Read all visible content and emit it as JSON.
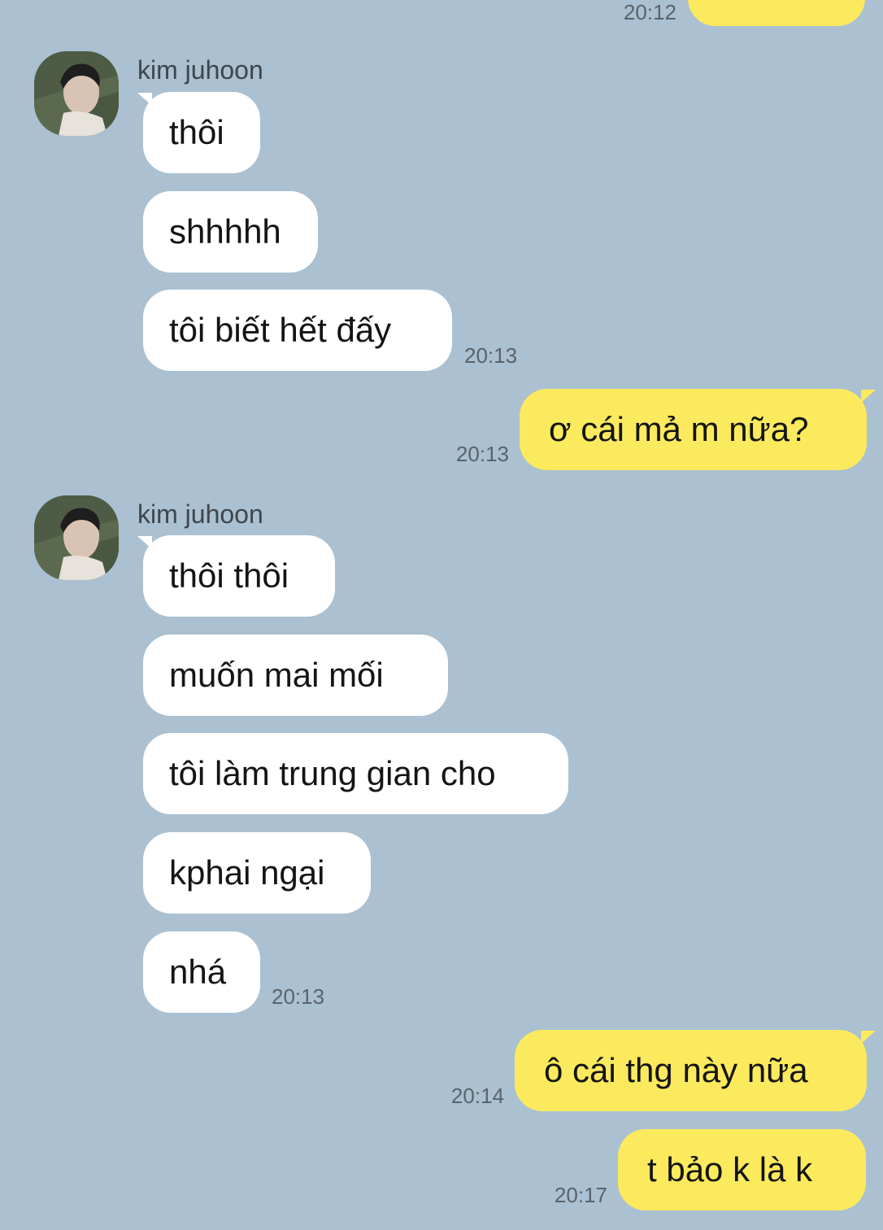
{
  "chat": {
    "top_partial": {
      "time": "20:12"
    },
    "group1": {
      "sender": "kim juhoon",
      "avatar_icon": "contact-photo-icon",
      "messages": [
        "thôi",
        "shhhhh",
        "tôi biết hết đấy"
      ],
      "time": "20:13"
    },
    "reply1": {
      "text": "ơ cái mả m nữa?",
      "time": "20:13"
    },
    "group2": {
      "sender": "kim juhoon",
      "avatar_icon": "contact-photo-icon",
      "messages": [
        "thôi thôi",
        "muốn mai mối",
        "tôi làm trung gian cho",
        "kphai ngại",
        "nhá"
      ],
      "time": "20:13"
    },
    "reply2": {
      "text": "ô cái thg này nữa",
      "time": "20:14"
    },
    "reply3": {
      "text": "t bảo k là k",
      "time": "20:17"
    }
  },
  "colors": {
    "background": "#abc1d1",
    "incoming_bubble": "#ffffff",
    "outgoing_bubble": "#fbea5d"
  }
}
